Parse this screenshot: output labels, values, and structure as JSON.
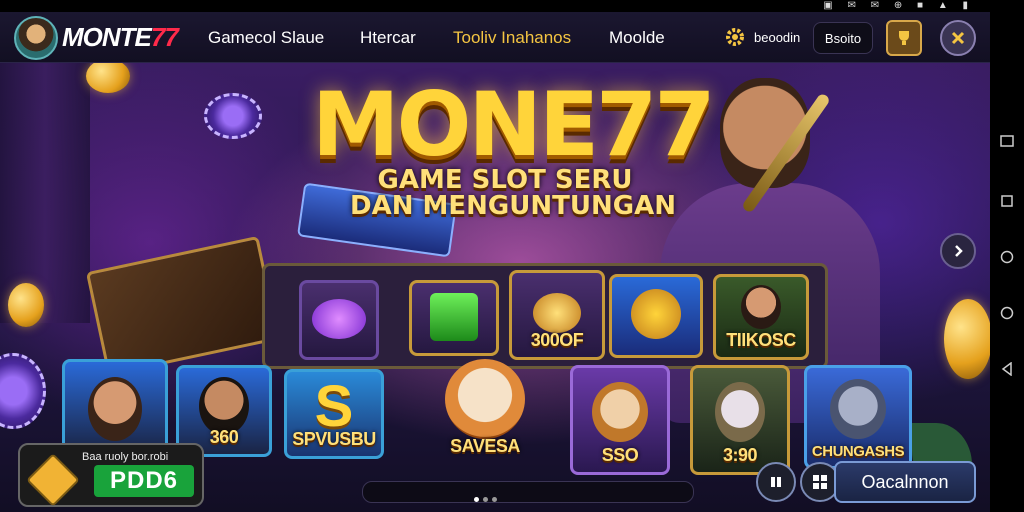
{
  "status_bar": {
    "icons": "▣ ✉ ✉ ⊕ ■ ▲ ▮"
  },
  "header": {
    "logo_white": "MONTE",
    "logo_red": "77",
    "nav": [
      {
        "label": "Gamecol Slaue",
        "active": false
      },
      {
        "label": "Htercar",
        "active": false
      },
      {
        "label": "Tooliv Inahanos",
        "active": true
      },
      {
        "label": "Moolde",
        "active": false
      }
    ],
    "gear_label": "beoodin",
    "account_label": "Bsoito"
  },
  "hero": {
    "title": "MONE77",
    "subtitle_line1": "GAME SLOT SERU",
    "subtitle_line2": "DAN MENGUNTUNGAN"
  },
  "board_tiles": [
    {
      "caption": ""
    },
    {
      "caption": ""
    },
    {
      "caption": "300OF"
    },
    {
      "caption": ""
    },
    {
      "caption": "TIIKOSC"
    }
  ],
  "game_cards": [
    {
      "caption": ""
    },
    {
      "caption": "360"
    },
    {
      "caption": "SPVUSBU"
    },
    {
      "caption": "SAVESA"
    },
    {
      "caption": "SSO"
    },
    {
      "caption": "3:90"
    },
    {
      "caption": "CHUNGASHS"
    }
  ],
  "balance": {
    "label": "Baa ruoly bor.robi",
    "value": "PDD6"
  },
  "cta_label": "Oacalnnon",
  "colors": {
    "accent_gold": "#ffd43a",
    "accent_red": "#ff2a4a",
    "balance_green": "#19a33b"
  }
}
